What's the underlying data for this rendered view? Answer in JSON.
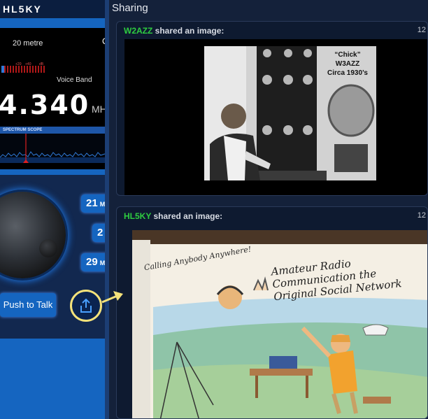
{
  "app": {
    "brand": "HL5KY"
  },
  "radio": {
    "band": "20 metre",
    "band_extra": "C",
    "meter_labels": [
      "+20",
      "+40",
      "dB"
    ],
    "mode": "Voice Band",
    "frequency": "4.340",
    "unit": "MH",
    "scope_label": "SPECTRUM SCOPE",
    "presets": [
      {
        "value": "21",
        "unit": "M"
      },
      {
        "value": "2",
        "unit": ""
      },
      {
        "value": "29",
        "unit": "M"
      }
    ],
    "ptt_label": "Push to Talk"
  },
  "sharing": {
    "title": "Sharing",
    "posts": [
      {
        "user": "W2AZZ",
        "action": "shared an image:",
        "time": "12",
        "caption": [
          "“Chick”",
          "W3AZZ",
          "Circa 1930’s"
        ]
      },
      {
        "user": "HL5KY",
        "action": "shared an image:",
        "time": "12",
        "sketch_text_1": "Calling Anybody Anywhere!",
        "sketch_text_2": "Amateur Radio Communication the Original Social Network"
      }
    ]
  },
  "colors": {
    "panel_blue": "#1565c0",
    "accent_green": "#2ecc40",
    "highlight_yellow": "#f4e27a"
  }
}
